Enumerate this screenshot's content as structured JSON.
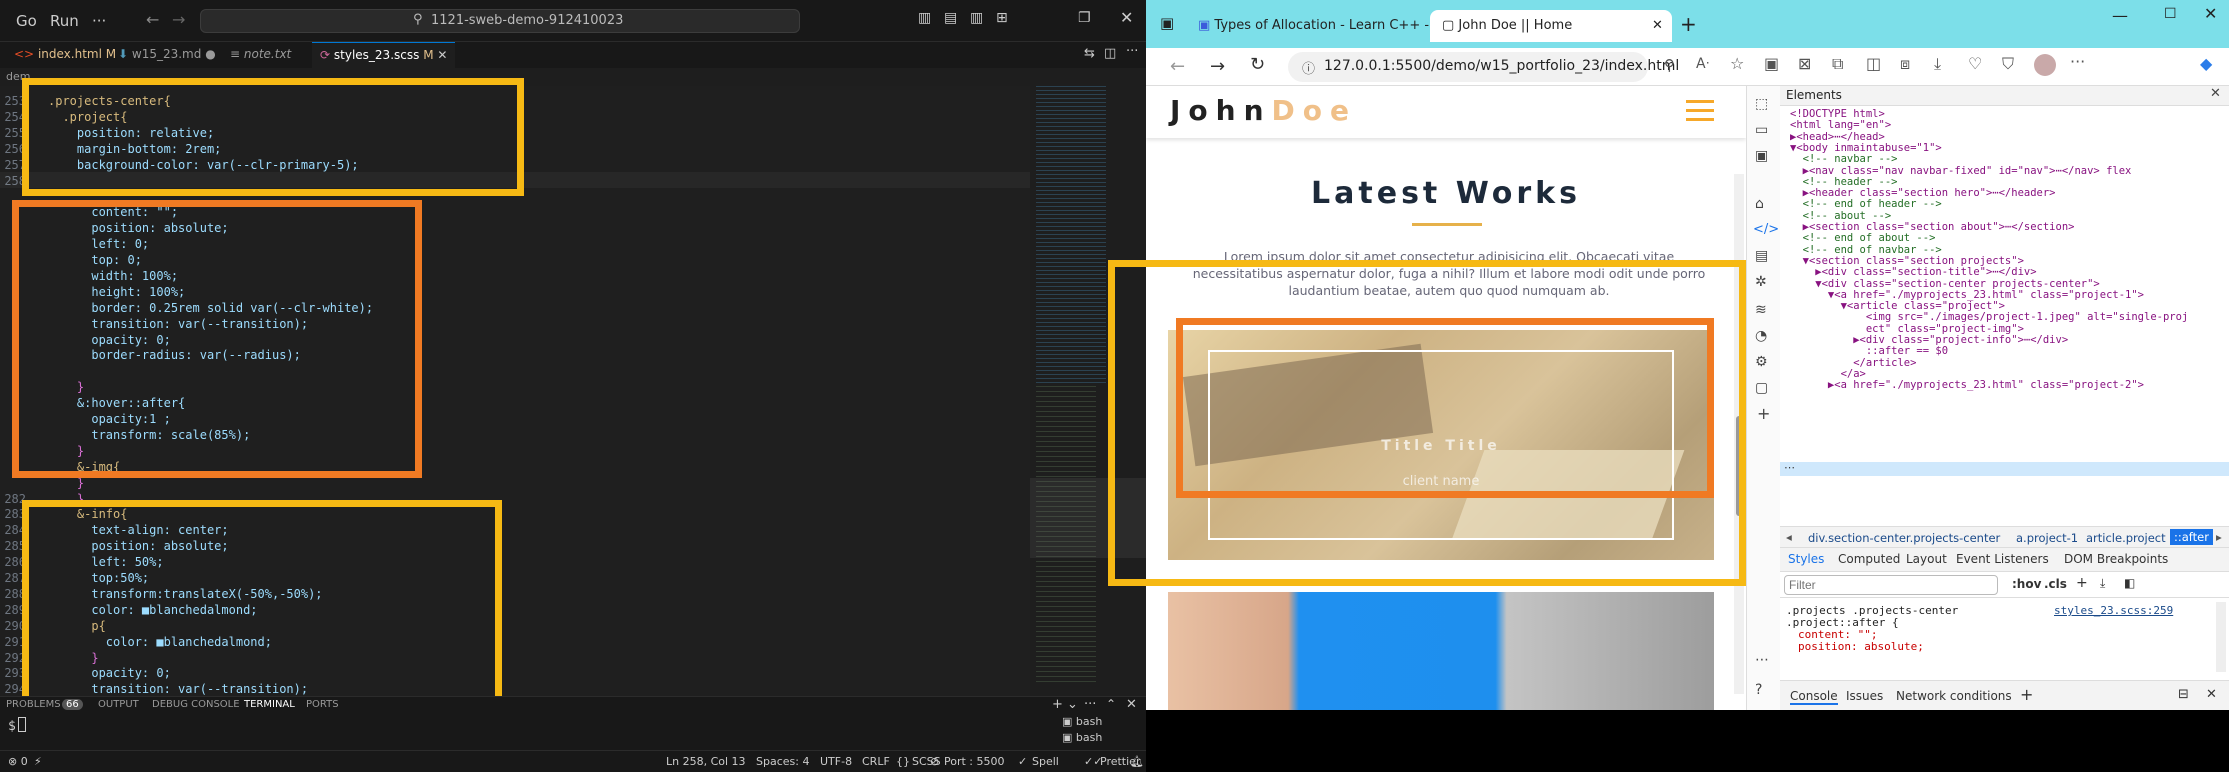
{
  "vscode": {
    "menu": [
      "Go",
      "Run"
    ],
    "more": "···",
    "search": "1121-sweb-demo-912410023",
    "tabs": [
      {
        "label": "index.html",
        "badge": "M"
      },
      {
        "label": "w15_23.md",
        "badge": "●"
      },
      {
        "label": "note.txt",
        "badge": ""
      },
      {
        "label": "styles_23.scss",
        "badge": "M"
      }
    ],
    "breadcrumb": "dem",
    "lines": [
      {
        "n": "253",
        "t": ".projects-center{"
      },
      {
        "n": "254",
        "t": "  .project{"
      },
      {
        "n": "255",
        "t": "    position: relative;"
      },
      {
        "n": "256",
        "t": "    margin-bottom: 2rem;"
      },
      {
        "n": "257",
        "t": "    background-color: var(--clr-primary-5);"
      },
      {
        "n": "258",
        "t": ""
      },
      {
        "n": "",
        "t": ""
      },
      {
        "n": "",
        "t": "      content: \"\";"
      },
      {
        "n": "",
        "t": "      position: absolute;"
      },
      {
        "n": "",
        "t": "      left: 0;"
      },
      {
        "n": "",
        "t": "      top: 0;"
      },
      {
        "n": "",
        "t": "      width: 100%;"
      },
      {
        "n": "",
        "t": "      height: 100%;"
      },
      {
        "n": "",
        "t": "      border: 0.25rem solid var(--clr-white);"
      },
      {
        "n": "",
        "t": "      transition: var(--transition);"
      },
      {
        "n": "",
        "t": "      opacity: 0;"
      },
      {
        "n": "",
        "t": "      border-radius: var(--radius);"
      },
      {
        "n": "",
        "t": ""
      },
      {
        "n": "",
        "t": "    }"
      },
      {
        "n": "",
        "t": "    &:hover::after{"
      },
      {
        "n": "",
        "t": "      opacity:1 ;"
      },
      {
        "n": "",
        "t": "      transform: scale(85%);"
      },
      {
        "n": "",
        "t": "    }"
      },
      {
        "n": "",
        "t": "    &-img{"
      },
      {
        "n": "",
        "t": "    }"
      },
      {
        "n": "282",
        "t": "    }"
      },
      {
        "n": "283",
        "t": "    &-info{"
      },
      {
        "n": "284",
        "t": "      text-align: center;"
      },
      {
        "n": "285",
        "t": "      position: absolute;"
      },
      {
        "n": "286",
        "t": "      left: 50%;"
      },
      {
        "n": "287",
        "t": "      top:50%;"
      },
      {
        "n": "288",
        "t": "      transform:translateX(-50%,-50%);"
      },
      {
        "n": "289",
        "t": "      color: ■blanchedalmond;"
      },
      {
        "n": "290",
        "t": "      p{"
      },
      {
        "n": "291",
        "t": "        color: ■blanchedalmond;"
      },
      {
        "n": "292",
        "t": "      }"
      },
      {
        "n": "293",
        "t": "      opacity: 0;"
      },
      {
        "n": "294",
        "t": "      transition: var(--transition);"
      }
    ],
    "panel_tabs": [
      "PROBLEMS",
      "66",
      "OUTPUT",
      "DEBUG CONSOLE",
      "TERMINAL",
      "PORTS"
    ],
    "prompt": "$",
    "terminals": [
      "bash",
      "bash"
    ],
    "status": {
      "left": "⊗ 0",
      "position": "Ln 258, Col 13",
      "spaces": "Spaces: 4",
      "encoding": "UTF-8",
      "eol": "CRLF",
      "lang": "SCSS",
      "port": "Port : 5500",
      "spell": "Spell",
      "prettier": "Prettier"
    }
  },
  "browser": {
    "tabs": [
      {
        "label": "Types of Allocation - Learn C++ -"
      },
      {
        "label": "John Doe || Home"
      }
    ],
    "url": "127.0.0.1:5500/demo/w15_portfolio_23/index.html",
    "site": {
      "logo_a": "John",
      "logo_b": "Doe",
      "section_title": "Latest Works",
      "lorem": "Lorem ipsum dolor sit amet consectetur adipisicing elit. Obcaecati vitae necessitatibus aspernatur dolor, fuga a nihil? Illum et labore modi odit unde porro laudantium beatae, autem quo quod numquam ab.",
      "project_title": "Title Title",
      "project_client": "client name"
    }
  },
  "devtools": {
    "panel": "Elements",
    "dom": [
      "<!DOCTYPE html>",
      "<html lang=\"en\">",
      "▶<head>⋯</head>",
      "▼<body inmaintabuse=\"1\">",
      "  <!-- navbar -->",
      "  ▶<nav class=\"nav navbar-fixed\" id=\"nav\">⋯</nav> flex",
      "  <!-- header -->",
      "  ▶<header class=\"section hero\">⋯</header>",
      "  <!-- end of header -->",
      "  <!-- about -->",
      "  ▶<section class=\"section about\">⋯</section>",
      "  <!-- end of about -->",
      "  <!-- end of navbar -->",
      "  ▼<section class=\"section projects\">",
      "    ▶<div class=\"section-title\">⋯</div>",
      "    ▼<div class=\"section-center projects-center\">",
      "      ▼<a href=\"./myprojects_23.html\" class=\"project-1\">",
      "        ▼<article class=\"project\">",
      "            <img src=\"./images/project-1.jpeg\" alt=\"single-proj",
      "            ect\" class=\"project-img\">",
      "          ▶<div class=\"project-info\">⋯</div>",
      "            ::after == $0",
      "          </article>",
      "        </a>",
      "      ▶<a href=\"./myprojects_23.html\" class=\"project-2\">"
    ],
    "crumbs": [
      "div.section-center.projects-center",
      "a.project-1",
      "article.project",
      "::after"
    ],
    "style_tabs": [
      "Styles",
      "Computed",
      "Layout",
      "Event Listeners",
      "DOM Breakpoints"
    ],
    "filter_placeholder": "Filter",
    "filter_tools": [
      ":hov",
      ".cls"
    ],
    "rule_selector": ".projects .projects-center",
    "rule_selector2": ".project::after {",
    "rule_source": "styles_23.scss:259",
    "rule_props": [
      "content: \"\";",
      "position: absolute;"
    ],
    "bottom_tabs": [
      "Console",
      "Issues",
      "Network conditions"
    ]
  },
  "colors": {
    "highlight_yellow": "#f6b914",
    "highlight_orange": "#f07a23",
    "accent": "#e6b14a"
  }
}
